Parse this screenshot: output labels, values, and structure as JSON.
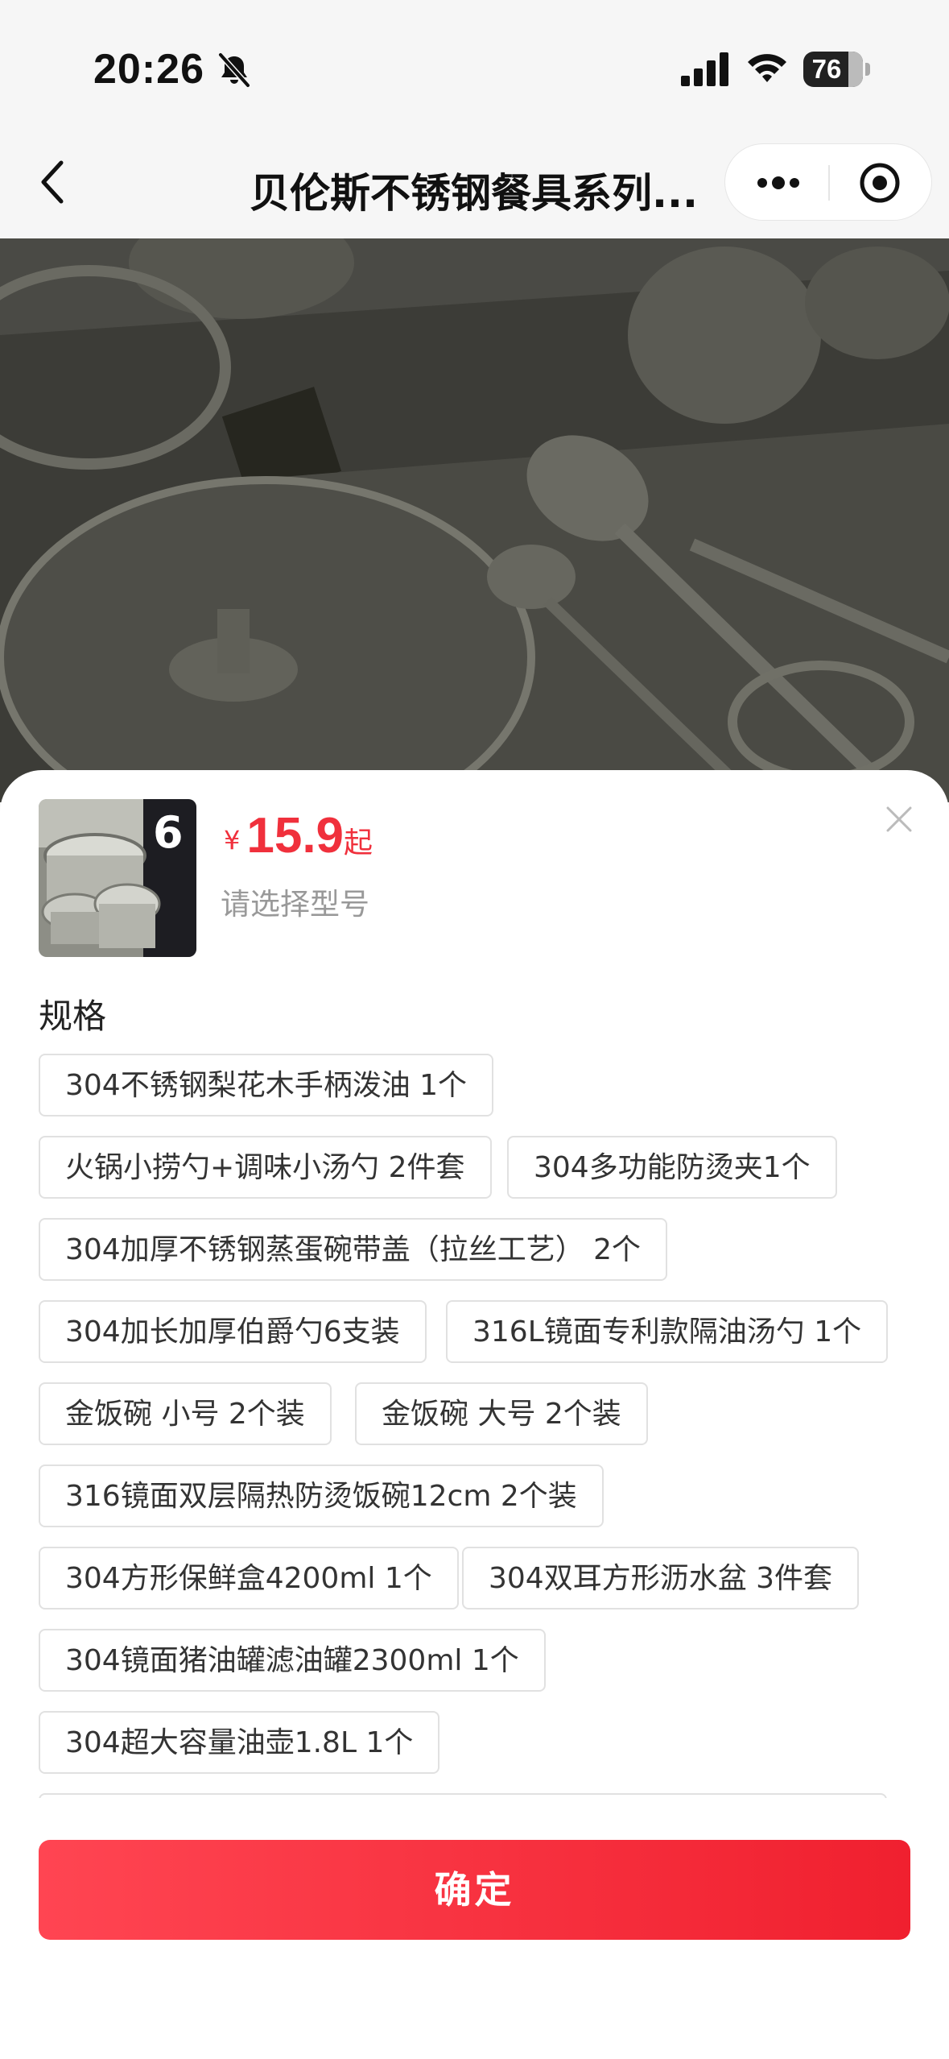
{
  "status_bar": {
    "time": "20:26",
    "battery_level": "76",
    "icons": [
      "bell-slash-icon",
      "cellular-signal-icon",
      "wifi-icon",
      "battery-icon"
    ]
  },
  "nav": {
    "title": "贝伦斯不锈钢餐具系列...",
    "icons": [
      "back-chevron-icon",
      "more-dots-icon",
      "target-icon"
    ]
  },
  "product": {
    "currency_symbol": "¥",
    "price": "15.9",
    "price_suffix": "起",
    "hint": "请选择型号"
  },
  "spec": {
    "title": "规格",
    "options": [
      "304不锈钢梨花木手柄泼油 1个",
      "火锅小捞勺+调味小汤勺 2件套",
      "304多功能防烫夹1个",
      "304加厚不锈钢蒸蛋碗带盖（拉丝工艺） 2个",
      "304加长加厚伯爵勺6支装",
      "316L镜面专利款隔油汤勺 1个",
      "金饭碗 小号 2个装",
      "金饭碗 大号 2个装",
      "316镜面双层隔热防烫饭碗12cm 2个装",
      "304方形保鲜盒4200ml 1个",
      "304双耳方形沥水盆 3件套",
      "304镜面猪油罐滤油罐2300ml 1个",
      "304超大容量油壶1.8L 1个",
      ""
    ]
  },
  "confirm_button": "确定",
  "colors": {
    "price_red": "#f0303c",
    "button_gradient_start": "#ff4552",
    "button_gradient_end": "#f0202f",
    "chip_border": "#e1e1e1"
  }
}
